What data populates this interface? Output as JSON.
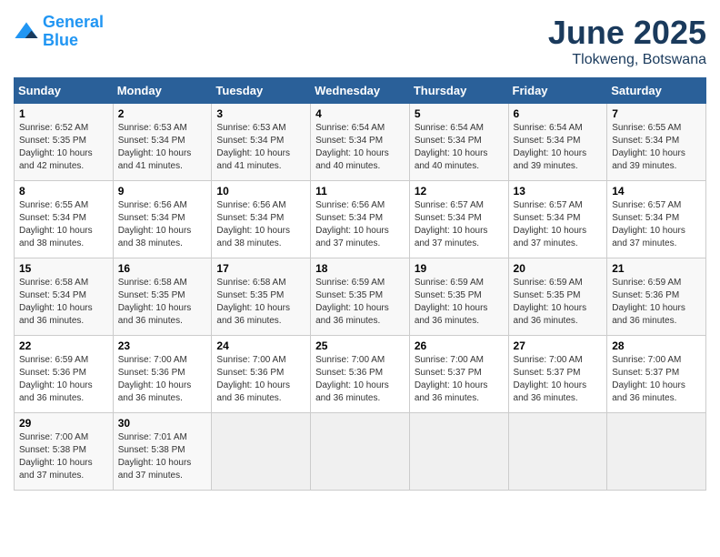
{
  "header": {
    "logo_line1": "General",
    "logo_line2": "Blue",
    "month_year": "June 2025",
    "location": "Tlokweng, Botswana"
  },
  "weekdays": [
    "Sunday",
    "Monday",
    "Tuesday",
    "Wednesday",
    "Thursday",
    "Friday",
    "Saturday"
  ],
  "weeks": [
    [
      {
        "day": "1",
        "sunrise": "6:52 AM",
        "sunset": "5:35 PM",
        "daylight": "10 hours and 42 minutes."
      },
      {
        "day": "2",
        "sunrise": "6:53 AM",
        "sunset": "5:34 PM",
        "daylight": "10 hours and 41 minutes."
      },
      {
        "day": "3",
        "sunrise": "6:53 AM",
        "sunset": "5:34 PM",
        "daylight": "10 hours and 41 minutes."
      },
      {
        "day": "4",
        "sunrise": "6:54 AM",
        "sunset": "5:34 PM",
        "daylight": "10 hours and 40 minutes."
      },
      {
        "day": "5",
        "sunrise": "6:54 AM",
        "sunset": "5:34 PM",
        "daylight": "10 hours and 40 minutes."
      },
      {
        "day": "6",
        "sunrise": "6:54 AM",
        "sunset": "5:34 PM",
        "daylight": "10 hours and 39 minutes."
      },
      {
        "day": "7",
        "sunrise": "6:55 AM",
        "sunset": "5:34 PM",
        "daylight": "10 hours and 39 minutes."
      }
    ],
    [
      {
        "day": "8",
        "sunrise": "6:55 AM",
        "sunset": "5:34 PM",
        "daylight": "10 hours and 38 minutes."
      },
      {
        "day": "9",
        "sunrise": "6:56 AM",
        "sunset": "5:34 PM",
        "daylight": "10 hours and 38 minutes."
      },
      {
        "day": "10",
        "sunrise": "6:56 AM",
        "sunset": "5:34 PM",
        "daylight": "10 hours and 38 minutes."
      },
      {
        "day": "11",
        "sunrise": "6:56 AM",
        "sunset": "5:34 PM",
        "daylight": "10 hours and 37 minutes."
      },
      {
        "day": "12",
        "sunrise": "6:57 AM",
        "sunset": "5:34 PM",
        "daylight": "10 hours and 37 minutes."
      },
      {
        "day": "13",
        "sunrise": "6:57 AM",
        "sunset": "5:34 PM",
        "daylight": "10 hours and 37 minutes."
      },
      {
        "day": "14",
        "sunrise": "6:57 AM",
        "sunset": "5:34 PM",
        "daylight": "10 hours and 37 minutes."
      }
    ],
    [
      {
        "day": "15",
        "sunrise": "6:58 AM",
        "sunset": "5:34 PM",
        "daylight": "10 hours and 36 minutes."
      },
      {
        "day": "16",
        "sunrise": "6:58 AM",
        "sunset": "5:35 PM",
        "daylight": "10 hours and 36 minutes."
      },
      {
        "day": "17",
        "sunrise": "6:58 AM",
        "sunset": "5:35 PM",
        "daylight": "10 hours and 36 minutes."
      },
      {
        "day": "18",
        "sunrise": "6:59 AM",
        "sunset": "5:35 PM",
        "daylight": "10 hours and 36 minutes."
      },
      {
        "day": "19",
        "sunrise": "6:59 AM",
        "sunset": "5:35 PM",
        "daylight": "10 hours and 36 minutes."
      },
      {
        "day": "20",
        "sunrise": "6:59 AM",
        "sunset": "5:35 PM",
        "daylight": "10 hours and 36 minutes."
      },
      {
        "day": "21",
        "sunrise": "6:59 AM",
        "sunset": "5:36 PM",
        "daylight": "10 hours and 36 minutes."
      }
    ],
    [
      {
        "day": "22",
        "sunrise": "6:59 AM",
        "sunset": "5:36 PM",
        "daylight": "10 hours and 36 minutes."
      },
      {
        "day": "23",
        "sunrise": "7:00 AM",
        "sunset": "5:36 PM",
        "daylight": "10 hours and 36 minutes."
      },
      {
        "day": "24",
        "sunrise": "7:00 AM",
        "sunset": "5:36 PM",
        "daylight": "10 hours and 36 minutes."
      },
      {
        "day": "25",
        "sunrise": "7:00 AM",
        "sunset": "5:36 PM",
        "daylight": "10 hours and 36 minutes."
      },
      {
        "day": "26",
        "sunrise": "7:00 AM",
        "sunset": "5:37 PM",
        "daylight": "10 hours and 36 minutes."
      },
      {
        "day": "27",
        "sunrise": "7:00 AM",
        "sunset": "5:37 PM",
        "daylight": "10 hours and 36 minutes."
      },
      {
        "day": "28",
        "sunrise": "7:00 AM",
        "sunset": "5:37 PM",
        "daylight": "10 hours and 36 minutes."
      }
    ],
    [
      {
        "day": "29",
        "sunrise": "7:00 AM",
        "sunset": "5:38 PM",
        "daylight": "10 hours and 37 minutes."
      },
      {
        "day": "30",
        "sunrise": "7:01 AM",
        "sunset": "5:38 PM",
        "daylight": "10 hours and 37 minutes."
      },
      null,
      null,
      null,
      null,
      null
    ]
  ],
  "labels": {
    "sunrise": "Sunrise:",
    "sunset": "Sunset:",
    "daylight": "Daylight:"
  }
}
